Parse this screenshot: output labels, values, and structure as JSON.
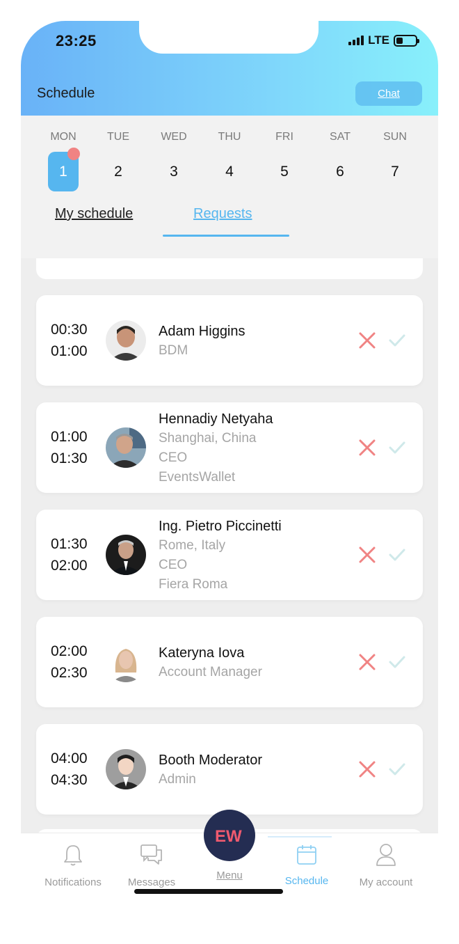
{
  "status_bar": {
    "time": "23:25",
    "network": "LTE"
  },
  "header": {
    "title": "Schedule",
    "chat_label": "Chat"
  },
  "calendar": {
    "days": [
      {
        "name": "MON",
        "num": "1"
      },
      {
        "name": "TUE",
        "num": "2"
      },
      {
        "name": "WED",
        "num": "3"
      },
      {
        "name": "THU",
        "num": "4"
      },
      {
        "name": "FRI",
        "num": "5"
      },
      {
        "name": "SAT",
        "num": "6"
      },
      {
        "name": "SUN",
        "num": "7"
      }
    ],
    "selected_day": "1"
  },
  "tabs": {
    "my_schedule": "My schedule",
    "requests": "Requests",
    "active": "Requests"
  },
  "requests": [
    {
      "start": "00:30",
      "end": "01:00",
      "name": "Adam Higgins",
      "details": [
        "BDM"
      ]
    },
    {
      "start": "01:00",
      "end": "01:30",
      "name": "Hennadiy Netyaha",
      "details": [
        "Shanghai, China",
        "CEO",
        "EventsWallet"
      ]
    },
    {
      "start": "01:30",
      "end": "02:00",
      "name": "Ing. Pietro Piccinetti",
      "details": [
        "Rome, Italy",
        "CEO",
        "Fiera Roma"
      ]
    },
    {
      "start": "02:00",
      "end": "02:30",
      "name": "Kateryna Iova",
      "details": [
        "Account Manager"
      ]
    },
    {
      "start": "04:00",
      "end": "04:30",
      "name": "Booth Moderator",
      "details": [
        "Admin"
      ]
    }
  ],
  "nav": {
    "notifications": "Notifications",
    "messages": "Messages",
    "menu": "Menu",
    "menu_logo": "EW",
    "schedule": "Schedule",
    "account": "My account",
    "active": "Schedule"
  },
  "colors": {
    "accent": "#56b6ef",
    "reject": "#f08383",
    "accept": "#cfe9ea",
    "menu_button": "#242d52"
  }
}
